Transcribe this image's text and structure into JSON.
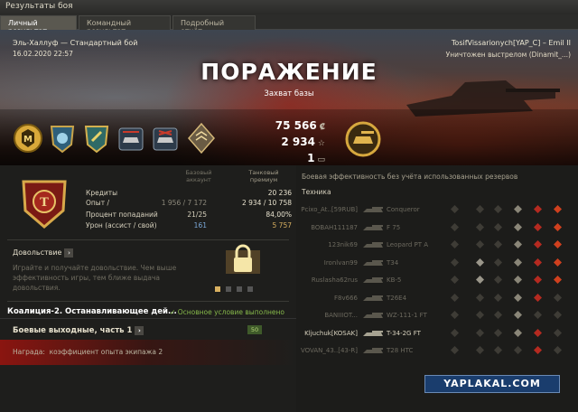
{
  "window": {
    "title": "Результаты боя"
  },
  "tabs": [
    {
      "label": "Личный результат",
      "active": true
    },
    {
      "label": "Командный результат",
      "active": false
    },
    {
      "label": "Подробный отчёт",
      "active": false
    }
  ],
  "battle": {
    "map_mode": "Эль-Халлуф — Стандартный бой",
    "datetime": "16.02.2020 22:57",
    "player": "TosifVissarionych[YAP_C] – Emil II",
    "killed_by": "Уничтожен выстрелом (Dinamit_...)",
    "result": "ПОРАЖЕНИЕ",
    "reason": "Захват базы"
  },
  "totals": {
    "credits": "75 566",
    "xp": "2 934",
    "free": "1"
  },
  "medals": [
    "m-badge-icon",
    "shield-blue-icon",
    "shield-teal-icon",
    "tank-stripes-icon",
    "tank-cross-icon",
    "diamond-rank-icon"
  ],
  "stats": {
    "col_basic": "Базовый аккаунт",
    "col_premium": "Танковый премиум",
    "rows": [
      {
        "label": "Кредиты",
        "basic": "",
        "premium": "20 236"
      },
      {
        "label": "Опыт / ",
        "basic": "1 956 / 7 172",
        "premium": "2 934 / 10 758"
      },
      {
        "label": "Процент попаданий",
        "basic": "21/25",
        "premium": "84,00%"
      },
      {
        "label": "Урон (ассист / свой)",
        "basic": "161",
        "premium": "5 757"
      }
    ]
  },
  "premium": {
    "title": "Довольствие",
    "text": "Играйте и получайте довольствие. Чем выше эффективность игры, тем ближе выдача довольствия."
  },
  "quests": {
    "title": "Коалиция-2. Останавливающее дей...",
    "status": "Основное условие выполнено",
    "q2_title": "Боевые выходные, часть 1",
    "q2_badge": "50",
    "reward_label": "Награда:",
    "reward_value": "коэффициент опыта экипажа 2"
  },
  "efficiency": {
    "title": "Боевая эффективность без учёта использованных резервов",
    "tech_header": "Техника",
    "rows": [
      {
        "player": "Pсixo_At..[59RUB]",
        "tank": "Conqueror",
        "alive": false
      },
      {
        "player": "BOBAH111187",
        "tank": "F 75",
        "alive": false
      },
      {
        "player": "123nik69",
        "tank": "Leopard PT A",
        "alive": false
      },
      {
        "player": "Ironlvan99",
        "tank": "T34",
        "alive": false
      },
      {
        "player": "Ruslasha62rus",
        "tank": "KB-5",
        "alive": false
      },
      {
        "player": "F8v666",
        "tank": "T26E4",
        "alive": false
      },
      {
        "player": "BANIIIOT...",
        "tank": "WZ-111-1 FT",
        "alive": false
      },
      {
        "player": "Kljuchuk[KOSAK]",
        "tank": "T-34-2G FT",
        "alive": true
      },
      {
        "player": "VOVAN_43..[43-R]",
        "tank": "T28 HTC",
        "alive": false
      }
    ]
  },
  "watermark": "YAPLAKAL.COM",
  "colors": {
    "defeat": "#ffffff",
    "ok": "#86b84a",
    "damage": "#d8b060",
    "danger": "#c0261c"
  }
}
